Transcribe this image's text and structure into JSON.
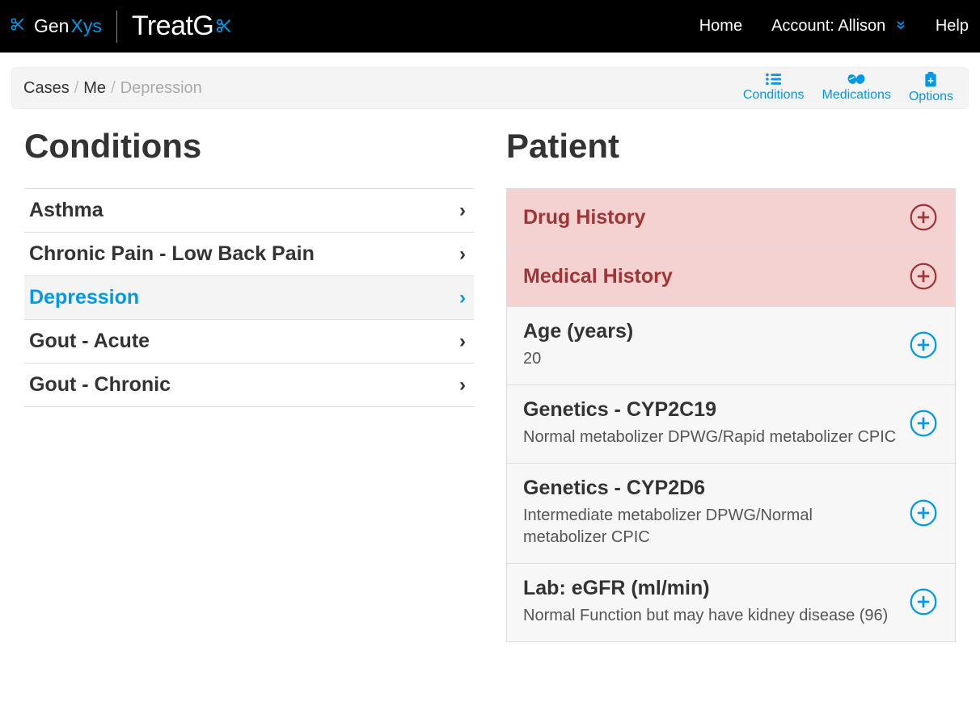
{
  "header": {
    "brand1_prefix": "Gen",
    "brand1_suffix": "Xys",
    "brand2_prefix": "Treat",
    "brand2_suffix": "G",
    "nav": {
      "home": "Home",
      "account_label": "Account: Allison",
      "help": "Help"
    }
  },
  "breadcrumb": {
    "root": "Cases",
    "mid": "Me",
    "current": "Depression"
  },
  "toolbar": {
    "conditions": "Conditions",
    "medications": "Medications",
    "options": "Options"
  },
  "left": {
    "title": "Conditions",
    "items": [
      {
        "label": "Asthma",
        "active": false
      },
      {
        "label": "Chronic Pain - Low Back Pain",
        "active": false
      },
      {
        "label": "Depression",
        "active": true
      },
      {
        "label": "Gout - Acute",
        "active": false
      },
      {
        "label": "Gout - Chronic",
        "active": false
      }
    ]
  },
  "right": {
    "title": "Patient",
    "items": [
      {
        "title": "Drug History",
        "sub": "",
        "alert": true
      },
      {
        "title": "Medical History",
        "sub": "",
        "alert": true
      },
      {
        "title": "Age (years)",
        "sub": "20",
        "alert": false
      },
      {
        "title": "Genetics - CYP2C19",
        "sub": "Normal metabolizer DPWG/Rapid metabolizer CPIC",
        "alert": false
      },
      {
        "title": "Genetics - CYP2D6",
        "sub": "Intermediate metabolizer DPWG/Normal metabolizer CPIC",
        "alert": false
      },
      {
        "title": "Lab: eGFR (ml/min)",
        "sub": "Normal Function but may have kidney disease (96)",
        "alert": false
      }
    ]
  }
}
